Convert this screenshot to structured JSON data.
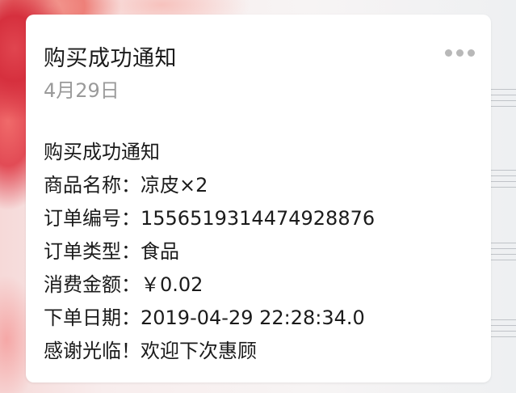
{
  "card": {
    "title": "购买成功通知",
    "date": "4月29日",
    "more_icon": "ellipsis-icon",
    "heading": "购买成功通知",
    "rows": [
      {
        "label": "商品名称：",
        "value": "凉皮×2"
      },
      {
        "label": "订单编号：",
        "value": "1556519314474928876"
      },
      {
        "label": "订单类型：",
        "value": "食品"
      },
      {
        "label": "消费金额：",
        "value": "￥0.02"
      },
      {
        "label": "下单日期：",
        "value": "2019-04-29 22:28:34.0"
      }
    ],
    "closing": "感谢光临！欢迎下次惠顾"
  },
  "colors": {
    "title_text": "#1b1b1b",
    "date_text": "#9a9a9a",
    "card_bg": "#ffffff",
    "dots": "#b8b8b8"
  }
}
